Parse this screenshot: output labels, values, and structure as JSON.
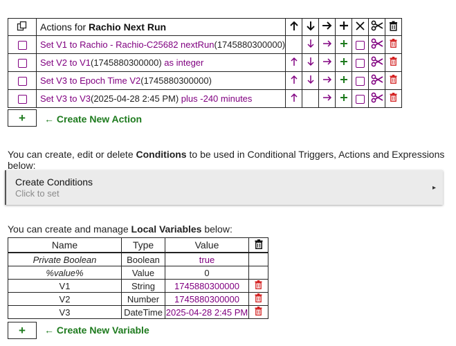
{
  "actions": {
    "header": {
      "title_prefix": "Actions for ",
      "title_name": "Rachio Next Run",
      "icons": [
        "copy-icon",
        "arrow-up-icon",
        "arrow-down-icon",
        "arrow-right-icon",
        "plus-icon",
        "close-icon",
        "scissors-icon",
        "trash-icon"
      ],
      "glyphs": {
        "up": "🡑",
        "down": "🡓",
        "right": "🡒",
        "plus": "+",
        "close": "✕",
        "scissors": "✂",
        "trash": "🗑"
      }
    },
    "rows": [
      {
        "parts": [
          {
            "text": "Set V1 to Rachio - Rachio-C25682 nextRun",
            "style": "purple"
          },
          {
            "text": "(1745880300000)",
            "style": "plain"
          }
        ],
        "up": false
      },
      {
        "parts": [
          {
            "text": "Set V2 to V1",
            "style": "purple"
          },
          {
            "text": "(1745880300000)",
            "style": "plain"
          },
          {
            "text": " as integer",
            "style": "purple"
          }
        ],
        "up": true
      },
      {
        "parts": [
          {
            "text": "Set V3 to Epoch Time V2",
            "style": "purple"
          },
          {
            "text": "(1745880300000)",
            "style": "plain"
          }
        ],
        "up": true
      },
      {
        "parts": [
          {
            "text": "Set V3 to V3",
            "style": "purple"
          },
          {
            "text": "(2025-04-28 2:45 PM)",
            "style": "plain"
          },
          {
            "text": " plus -240 minutes",
            "style": "purple"
          }
        ],
        "up": true,
        "no_down": true
      }
    ],
    "add_label": "+",
    "create_label": "← Create New Action"
  },
  "conditions": {
    "intro_prefix": "You can create, edit or delete ",
    "intro_bold": "Conditions",
    "intro_suffix": " to be used in Conditional Triggers, Actions and Expressions below:",
    "panel_title": "Create Conditions",
    "panel_sub": "Click to set",
    "panel_arrow": "▸"
  },
  "variables": {
    "intro_prefix": "You can create and manage ",
    "intro_bold": "Local Variables",
    "intro_suffix": " below:",
    "headers": {
      "name": "Name",
      "type": "Type",
      "value": "Value"
    },
    "rows": [
      {
        "name": "Private Boolean",
        "type": "Boolean",
        "value": "true",
        "italic": true,
        "value_purple": true,
        "trash": false
      },
      {
        "name": "%value%",
        "type": "Value",
        "value": "0",
        "italic": true,
        "value_purple": false,
        "trash": false
      },
      {
        "name": "V1",
        "type": "String",
        "value": "1745880300000",
        "italic": false,
        "value_purple": true,
        "trash": true
      },
      {
        "name": "V2",
        "type": "Number",
        "value": "1745880300000",
        "italic": false,
        "value_purple": true,
        "trash": true
      },
      {
        "name": "V3",
        "type": "DateTime",
        "value": "2025-04-28 2:45 PM",
        "italic": false,
        "value_purple": true,
        "trash": true
      }
    ],
    "add_label": "+",
    "create_label": "← Create New Variable"
  }
}
